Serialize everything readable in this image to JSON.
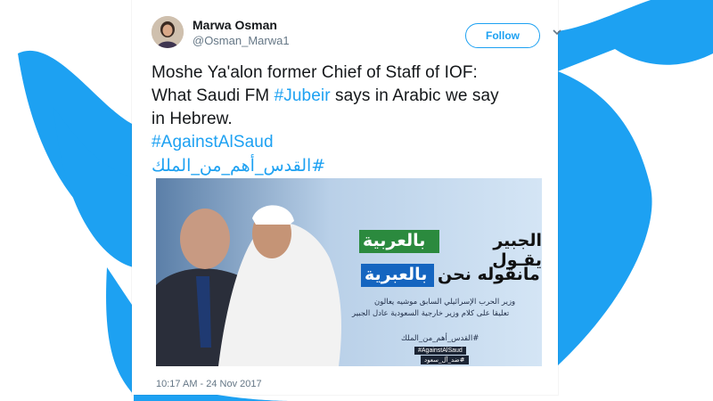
{
  "tweet": {
    "author_name": "Marwa Osman",
    "author_handle": "@Osman_Marwa1",
    "follow_label": "Follow",
    "text_line1": "Moshe Ya'alon former Chief of Staff of IOF:",
    "text_line2_pre": "What Saudi FM ",
    "text_line2_tag": "#Jubeir",
    "text_line2_post": " says in Arabic we say",
    "text_line3": "in Hebrew.",
    "hashtag1": "#AgainstAlSaud",
    "hashtag2": "#القدس_أهم_من_الملك",
    "timestamp": "10:17 AM - 24 Nov 2017"
  },
  "image": {
    "line1_prefix": "الجبير يقـول",
    "line1_highlight": "بالعربية",
    "line2_prefix": "مانقوله نحن",
    "line2_highlight": "بالعبرية",
    "caption_line1": "وزير الحرب الإسرائيلي السابق موشيه يعالون",
    "caption_line2": "تعليقا على كلام وزير خارجية السعودية عادل الجبير",
    "hashtag_ar": "#القدس_أهم_من_الملك",
    "tag_box1": "#AgainstAlSaud",
    "tag_box2": "#ضد_آل_سعود"
  },
  "colors": {
    "twitter_blue": "#1da1f2",
    "highlight_green": "#2b8a3e",
    "highlight_blue": "#1565c0"
  },
  "icons": [
    "twitter-bird-icon",
    "chevron-down-icon"
  ]
}
